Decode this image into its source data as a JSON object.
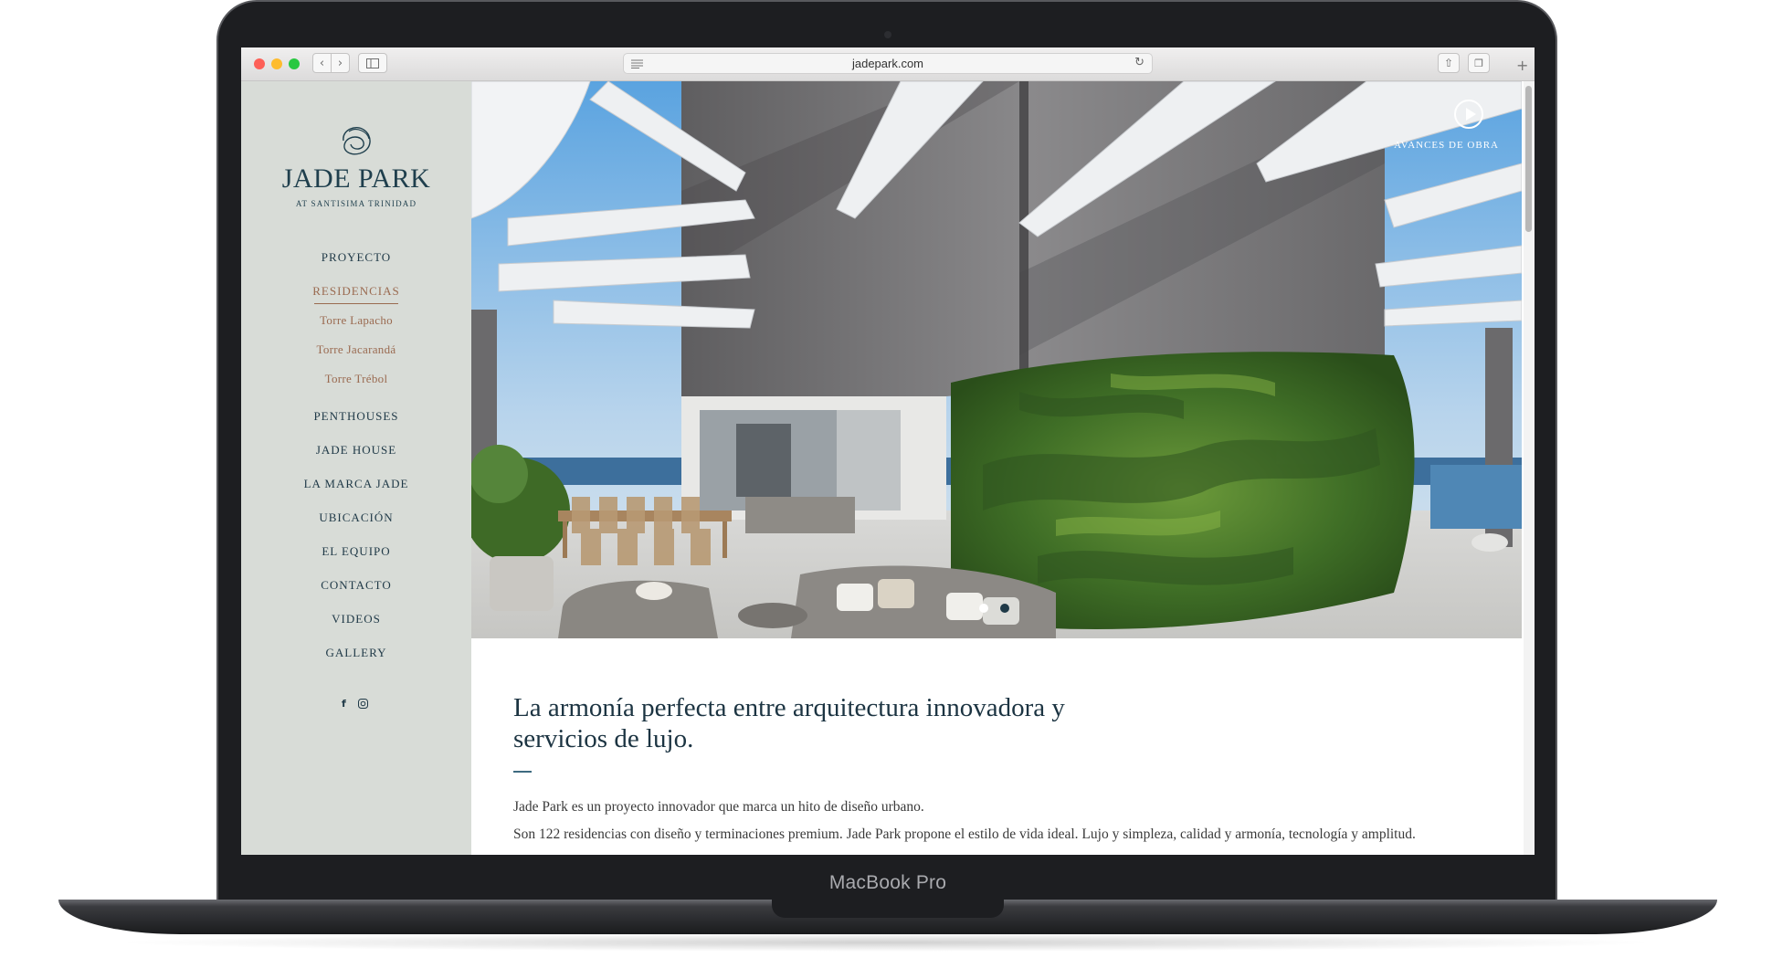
{
  "device": {
    "label": "MacBook Pro"
  },
  "browser": {
    "url": "jadepark.com",
    "traffic_colors": [
      "#fd5f57",
      "#febc2e",
      "#28c840"
    ],
    "icons": [
      "back-icon",
      "forward-icon",
      "sidebar-icon",
      "reader-icon",
      "reload-icon",
      "share-icon",
      "tabs-icon",
      "new-tab-icon"
    ]
  },
  "site": {
    "brand": {
      "name": "JADE PARK",
      "tagline": "AT SANTISIMA TRINIDAD"
    },
    "nav": [
      {
        "label": "PROYECTO"
      },
      {
        "label": "RESIDENCIAS",
        "active": true
      },
      {
        "label": "Torre Lapacho",
        "sub": true
      },
      {
        "label": "Torre Jacarandá",
        "sub": true
      },
      {
        "label": "Torre Trébol",
        "sub": true
      },
      {
        "label": "PENTHOUSES"
      },
      {
        "label": "JADE HOUSE"
      },
      {
        "label": "LA MARCA JADE"
      },
      {
        "label": "UBICACIÓN"
      },
      {
        "label": "EL EQUIPO"
      },
      {
        "label": "CONTACTO"
      },
      {
        "label": "VIDEOS"
      },
      {
        "label": "GALLERY"
      }
    ],
    "social": [
      "facebook-icon",
      "instagram-icon"
    ],
    "hero": {
      "video_label": "AVANCES DE OBRA",
      "slides": 2,
      "active_slide": 2
    },
    "content": {
      "title": "La armonía perfecta entre arquitectura innovadora y servicios de lujo.",
      "paragraphs": [
        "Jade Park es un proyecto innovador que marca un hito de diseño urbano.",
        "Son 122 residencias con diseño y terminaciones premium. Jade Park propone el estilo de vida ideal. Lujo y simpleza, calidad y armonía, tecnología y amplitud."
      ]
    }
  }
}
